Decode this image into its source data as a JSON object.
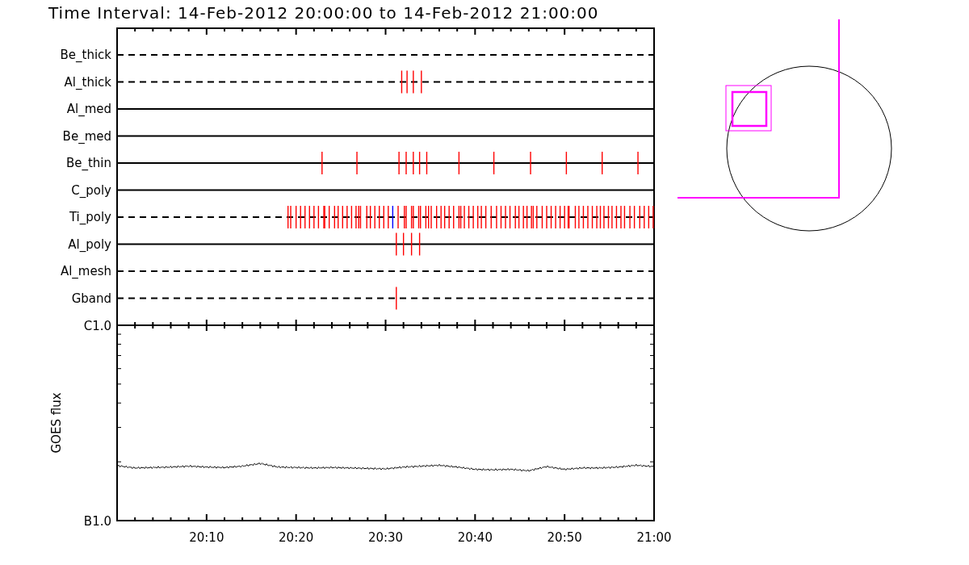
{
  "title": "Time Interval: 14-Feb-2012 20:00:00 to 14-Feb-2012 21:00:00",
  "filter_panel": {
    "rows": [
      {
        "label": "Be_thick",
        "kind": "dashed"
      },
      {
        "label": "Al_thick",
        "kind": "dashed"
      },
      {
        "label": "Al_med",
        "kind": "solid"
      },
      {
        "label": "Be_med",
        "kind": "solid"
      },
      {
        "label": "Be_thin",
        "kind": "solid"
      },
      {
        "label": "C_poly",
        "kind": "solid"
      },
      {
        "label": "Ti_poly",
        "kind": "dashed"
      },
      {
        "label": "Al_poly",
        "kind": "solid"
      },
      {
        "label": "Al_mesh",
        "kind": "dashed"
      },
      {
        "label": "Gband",
        "kind": "dashed"
      }
    ]
  },
  "goes_panel": {
    "ylabel": "GOES flux",
    "y_tick_labels": [
      "C1.0",
      "B1.0"
    ],
    "x_tick_labels": [
      "20:10",
      "20:20",
      "20:30",
      "20:40",
      "20:50",
      "21:00"
    ]
  }
}
